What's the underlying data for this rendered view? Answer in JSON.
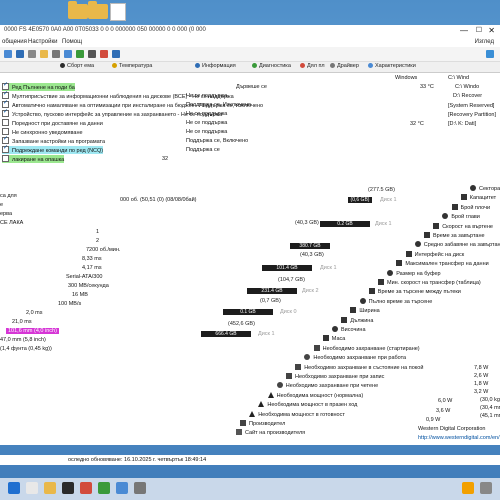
{
  "window": {
    "title": "0000 FS 4E0570 0A0 A00 0T05033 0 0 0 000000 050 00000 0 0 000 (0 000",
    "right_label": "Изглед"
  },
  "menu": [
    "общения",
    "Настройки",
    "Помощ"
  ],
  "tabs": [
    "Сборт ема",
    "Температура",
    "Информация",
    "Диагностика",
    "Дял пл",
    "Драйвер",
    "Характеристики"
  ],
  "left_rows": [
    {
      "text": "Ред Пълнене на поди ба",
      "checked": true,
      "hl": "green"
    },
    {
      "text": "Мултиприсъствие за информационни наблюдения на дискове (ВСЕ) - Не се поддържа",
      "checked": true,
      "hl": "none"
    },
    {
      "text": "Автоматично намаляване на оптимизации при инсталиране на бюджет - Поддържа се, изключено",
      "checked": true,
      "hl": "none"
    },
    {
      "text": "Устройство, пусково интерфейс за управление на захранването - Не се поддържа",
      "checked": true,
      "hl": "none"
    },
    {
      "text": "Поредност при доставяне на данни",
      "checked": false,
      "hl": "none"
    },
    {
      "text": "Не синхронно уведомяване",
      "checked": false,
      "hl": "none"
    },
    {
      "text": "Запазване настройки на програмата",
      "checked": true,
      "hl": "none"
    },
    {
      "text": "Подреждане команди по ред (NCQ)",
      "checked": true,
      "hl": "cyan"
    },
    {
      "text": "лакиране на опашка",
      "checked": false,
      "hl": "green"
    }
  ],
  "left_values": [
    "Дървеше се",
    "Не се поддържа",
    "Поддържа се, Изключено",
    "Не се поддържа",
    "Не се поддържа",
    "Не се поддържа",
    "Поддържа се, Включено",
    "Поддържа се",
    "32"
  ],
  "top_right": [
    {
      "label": "Windows",
      "value": "C:\\ Wind"
    },
    {
      "label": "33 °C",
      "value": "C:\\ Windo"
    },
    {
      "label": "",
      "value": "D:\\ Recover"
    },
    {
      "label": "",
      "value": "[System Reserved]"
    },
    {
      "label": "",
      "value": "[Recovery Partition]"
    },
    {
      "label": "32 °C",
      "value": "[D:\\ K: Dati]"
    },
    {
      "label": "",
      "value": "Diagnostics"
    }
  ],
  "mid_values": [
    "(277.5 GB)",
    "Диск 1",
    "(0,6 GB)",
    "0.2 GB",
    "Диск 1",
    "(40,3 GB)",
    "380.7 GB",
    "Диск 3",
    "(111,3 GB)",
    "101.4 GB",
    "Диск 1",
    "(104,7 GB)",
    "231.4 GB",
    "Диск 2",
    "(0,7 GB)",
    "0.1 GB",
    "Диск 0",
    "(452,6 GB)",
    "666.4 GB",
    "Диск 1"
  ],
  "left_info": [
    "са для",
    "е",
    "ерва",
    "СЕ ЛАКА",
    "1",
    "2",
    "7200 об./мин.",
    "8,33 ms",
    "4,17 ms",
    "Serial-ATA/300",
    "300 MB/секунда",
    "16 MB",
    "100 MB/s",
    "2,0 ms",
    "21,0 ms",
    "101,6 mm (4,0 inch)",
    "47,0 mm (5,8 inch)",
    "(1,4 фунта (0,45 kg))"
  ],
  "center_info": "000 об. (50,51 (0) (08/08/0бай)",
  "props": [
    "Секторазч",
    "Капацитет",
    "Брой плочи",
    "Брой глави",
    "Скорост на въртене",
    "Време за завъртане",
    "Средно забавяне на завъртане",
    "Интерфейс на диск",
    "Максимален трансфер на данни",
    "Размер на буфер",
    "Мин. скорост на трансфер (таблица)",
    "Време за търсене между пътеки",
    "Пълно време за търсене",
    "Ширина",
    "Дължина",
    "Височина",
    "Маса",
    "Необходимо захранване (стартиране)",
    "Необходимо захранване при работа",
    "Необходимо захранване в състояние на покой",
    "Необходимо захранване при запис",
    "Необходимо захранване при четене",
    "Необходима мощност (нормална)",
    "Необходима мощност в празен ход",
    "Необходима мощност в готовност",
    "Производител",
    "Сайт на производителя"
  ],
  "prop_values": [
    "3",
    "6,0 W",
    "3,6 W",
    "0,9 W",
    "Western Digital Corporation",
    "http://www.westerndigital.com/en/"
  ],
  "right_numbers": [
    "7,8 W",
    "2,6 W",
    "1,8 W",
    "3,2 W",
    "(30,0 kg)",
    "(30,4 mm)",
    "(45,1 mm)"
  ],
  "status_text": "оследно обновяване: 16.10.2025 г. четвъртък 18:49:14",
  "colors": {
    "bar_dark": "#1d1d1d",
    "bar_gray": "#555555",
    "highlight_green": "#9be78f",
    "highlight_cyan": "#9fe8f2",
    "accent_blue": "#0050a0"
  }
}
